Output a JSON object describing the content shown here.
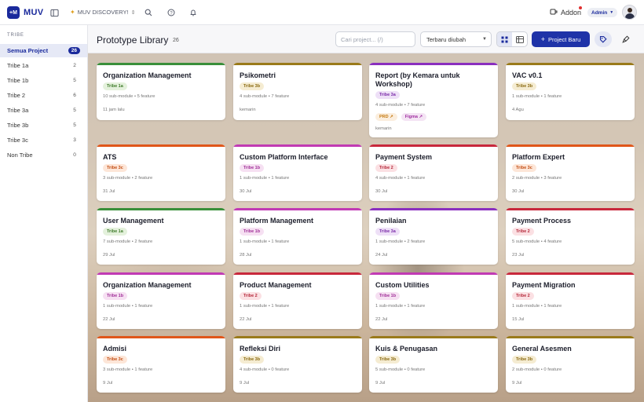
{
  "app": {
    "logo_mark": "+M",
    "logo_text": "MUV",
    "workspace": "MUV DISCOVERY!",
    "addon_label": "Addon",
    "admin_label": "Admin"
  },
  "icons": {
    "sidebar_toggle": "sidebar-toggle-icon",
    "search": "search-icon",
    "help": "help-icon",
    "bell": "bell-icon",
    "addon": "puzzle-icon",
    "user": "user-avatar"
  },
  "sidebar": {
    "heading": "TRIBE",
    "items": [
      {
        "label": "Semua Project",
        "count": "26"
      },
      {
        "label": "Tribe 1a",
        "count": "2"
      },
      {
        "label": "Tribe 1b",
        "count": "5"
      },
      {
        "label": "Tribe 2",
        "count": "6"
      },
      {
        "label": "Tribe 3a",
        "count": "5"
      },
      {
        "label": "Tribe 3b",
        "count": "5"
      },
      {
        "label": "Tribe 3c",
        "count": "3"
      },
      {
        "label": "Non Tribe",
        "count": "0"
      }
    ]
  },
  "header": {
    "title": "Prototype Library",
    "count": "26",
    "search_placeholder": "Cari project... (/)",
    "sort_value": "Terbaru diubah",
    "new_button": "Project Baru"
  },
  "tribe_colors": {
    "Tribe 1a": {
      "stripe": "#3a8f3a",
      "bg": "#e4f1dc",
      "fg": "#3e7a2a"
    },
    "Tribe 1b": {
      "stripe": "#c13ab4",
      "bg": "#f6e0f2",
      "fg": "#a02f98"
    },
    "Tribe 2": {
      "stripe": "#c8283c",
      "bg": "#fbe0e3",
      "fg": "#b5283a"
    },
    "Tribe 3a": {
      "stripe": "#8a2fbf",
      "bg": "#eee0f7",
      "fg": "#7a2aa8"
    },
    "Tribe 3b": {
      "stripe": "#9a7a1a",
      "bg": "#f5ecd2",
      "fg": "#8a6a12"
    },
    "Tribe 3c": {
      "stripe": "#e0561a",
      "bg": "#fde6d8",
      "fg": "#c24c12"
    }
  },
  "cards": [
    {
      "title": "Organization Management",
      "tribe": "Tribe 1a",
      "meta": "10 sub-module • 5 feature",
      "date": "11 jam lalu"
    },
    {
      "title": "Psikometri",
      "tribe": "Tribe 3b",
      "meta": "4 sub-module • 7 feature",
      "date": "kemarin"
    },
    {
      "title": "Report (by Kemara untuk Workshop)",
      "tribe": "Tribe 3a",
      "meta": "4 sub-module • 7 feature",
      "date": "kemarin",
      "links": [
        "PRD ↗",
        "Figma ↗"
      ]
    },
    {
      "title": "VAC v0.1",
      "tribe": "Tribe 3b",
      "meta": "1 sub-module • 1 feature",
      "date": "4 Agu"
    },
    {
      "title": "ATS",
      "tribe": "Tribe 3c",
      "meta": "3 sub-module • 2 feature",
      "date": "31 Jul"
    },
    {
      "title": "Custom Platform Interface",
      "tribe": "Tribe 1b",
      "meta": "1 sub-module • 1 feature",
      "date": "30 Jul"
    },
    {
      "title": "Payment System",
      "tribe": "Tribe 2",
      "meta": "4 sub-module • 1 feature",
      "date": "30 Jul"
    },
    {
      "title": "Platform Expert",
      "tribe": "Tribe 3c",
      "meta": "2 sub-module • 3 feature",
      "date": "30 Jul"
    },
    {
      "title": "User Management",
      "tribe": "Tribe 1a",
      "meta": "7 sub-module • 2 feature",
      "date": "29 Jul"
    },
    {
      "title": "Platform Management",
      "tribe": "Tribe 1b",
      "meta": "1 sub-module • 1 feature",
      "date": "28 Jul"
    },
    {
      "title": "Penilaian",
      "tribe": "Tribe 3a",
      "meta": "1 sub-module • 2 feature",
      "date": "24 Jul"
    },
    {
      "title": "Payment Process",
      "tribe": "Tribe 2",
      "meta": "5 sub-module • 4 feature",
      "date": "23 Jul"
    },
    {
      "title": "Organization Management",
      "tribe": "Tribe 1b",
      "meta": "1 sub-module • 1 feature",
      "date": "22 Jul"
    },
    {
      "title": "Product Management",
      "tribe": "Tribe 2",
      "meta": "1 sub-module • 1 feature",
      "date": "22 Jul"
    },
    {
      "title": "Custom Utilities",
      "tribe": "Tribe 1b",
      "meta": "1 sub-module • 1 feature",
      "date": "22 Jul"
    },
    {
      "title": "Payment Migration",
      "tribe": "Tribe 2",
      "meta": "1 sub-module • 1 feature",
      "date": "15 Jul"
    },
    {
      "title": "Admisi",
      "tribe": "Tribe 3c",
      "meta": "3 sub-module • 1 feature",
      "date": "9 Jul"
    },
    {
      "title": "Refleksi Diri",
      "tribe": "Tribe 3b",
      "meta": "4 sub-module • 0 feature",
      "date": "9 Jul"
    },
    {
      "title": "Kuis & Penugasan",
      "tribe": "Tribe 3b",
      "meta": "5 sub-module • 0 feature",
      "date": "9 Jul"
    },
    {
      "title": "General Asesmen",
      "tribe": "Tribe 3b",
      "meta": "2 sub-module • 0 feature",
      "date": "9 Jul"
    }
  ]
}
